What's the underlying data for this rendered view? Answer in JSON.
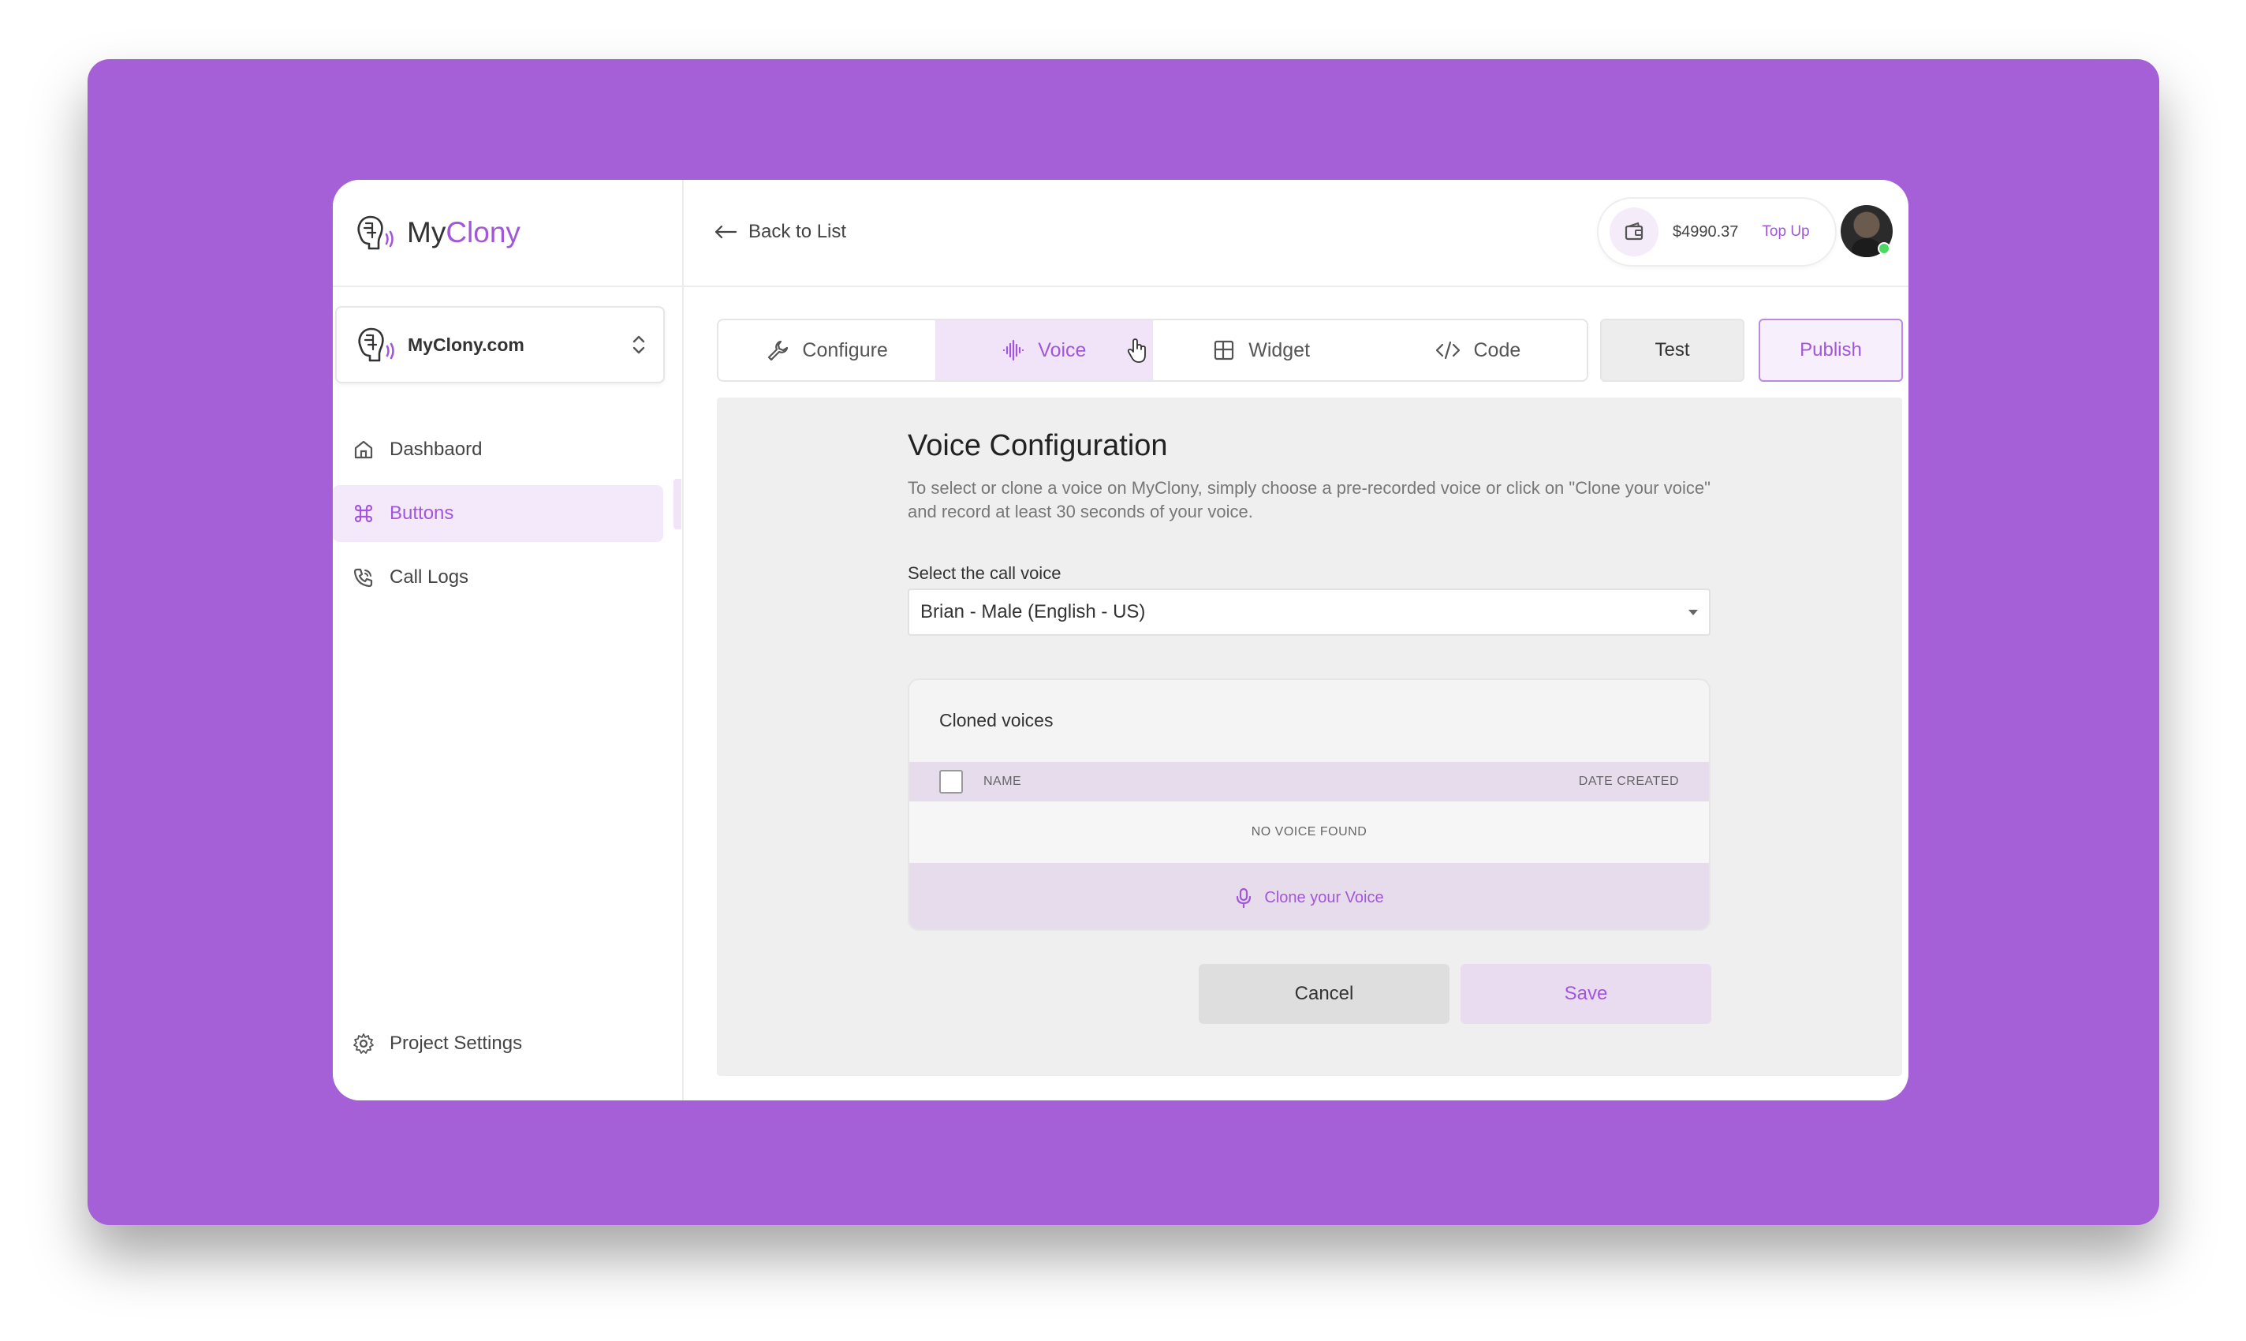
{
  "brand": {
    "name_plain": "My",
    "name_accent": "Clony"
  },
  "workspace": {
    "name": "MyClony.com"
  },
  "sidebar": {
    "items": [
      {
        "label": "Dashbaord",
        "icon": "home-icon"
      },
      {
        "label": "Buttons",
        "icon": "command-icon",
        "active": true
      },
      {
        "label": "Call Logs",
        "icon": "phone-icon"
      }
    ],
    "footer": {
      "label": "Project Settings",
      "icon": "gear-icon"
    }
  },
  "topbar": {
    "back_label": "Back to List",
    "balance": "$4990.37",
    "topup_label": "Top Up"
  },
  "tabs": [
    {
      "label": "Configure",
      "icon": "wrench-icon"
    },
    {
      "label": "Voice",
      "icon": "waveform-icon",
      "active": true
    },
    {
      "label": "Widget",
      "icon": "grid-icon"
    },
    {
      "label": "Code",
      "icon": "code-icon"
    }
  ],
  "actions": {
    "test_label": "Test",
    "publish_label": "Publish"
  },
  "voice_config": {
    "title": "Voice Configuration",
    "description": "To select or clone a voice on MyClony, simply choose a pre-recorded voice or click on \"Clone your voice\" and record at least 30 seconds of your voice.",
    "select_label": "Select the call voice",
    "selected_voice": "Brian - Male (English - US)",
    "cloned": {
      "title": "Cloned voices",
      "col_name": "NAME",
      "col_date": "DATE CREATED",
      "empty_text": "NO VOICE FOUND",
      "clone_label": "Clone your Voice"
    },
    "cancel_label": "Cancel",
    "save_label": "Save"
  },
  "colors": {
    "accent": "#a256d9",
    "backdrop": "#a560d8",
    "active_bg": "#f1e4f8"
  }
}
